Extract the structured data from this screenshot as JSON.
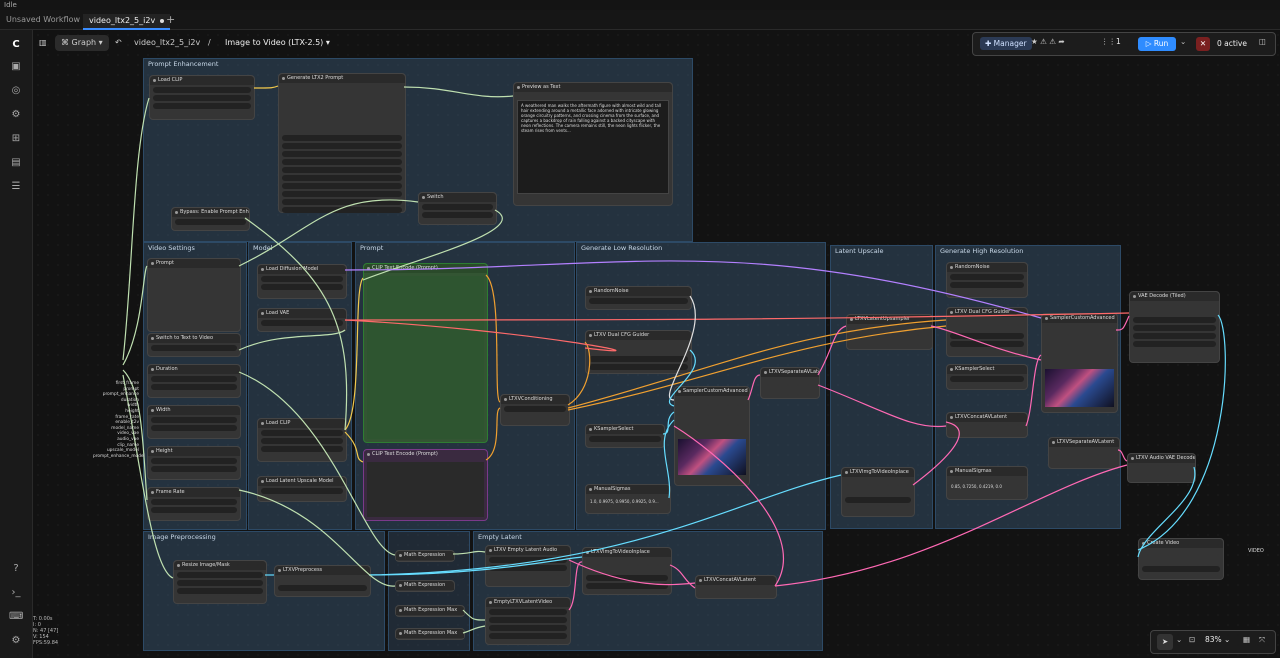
{
  "window": {
    "title": "Idle"
  },
  "tabs": [
    {
      "label": "Unsaved Workflow",
      "active": false
    },
    {
      "label": "video_ltx2_5_i2v",
      "active": true
    }
  ],
  "topbar": {
    "mode": "Graph",
    "breadcrumb_file": "video_ltx2_5_i2v",
    "breadcrumb_sep": "/",
    "breadcrumb_title": "Image to Video (LTX-2.5)"
  },
  "run_controls": {
    "manager": "Manager",
    "batch_count": "1",
    "run": "Run",
    "active": "0 active"
  },
  "zoom": {
    "level": "83%"
  },
  "stats": [
    "T: 0.00s",
    "I: 0",
    "N: 47 [47]",
    "V: 154",
    "FPS:59.84"
  ],
  "groups": [
    {
      "title": "Prompt Enhancement"
    },
    {
      "title": "Video Settings"
    },
    {
      "title": "Model"
    },
    {
      "title": "Prompt"
    },
    {
      "title": "Generate Low Resolution"
    },
    {
      "title": "Latent Upscale"
    },
    {
      "title": "Generate High Resolution"
    },
    {
      "title": "Image Preprocessing"
    },
    {
      "title": "Empty Latent"
    }
  ],
  "nodes": [
    {
      "title": "Load CLIP"
    },
    {
      "title": "Generate LTX2 Prompt"
    },
    {
      "title": "Preview as Text"
    },
    {
      "title": "Bypass: Enable Prompt Enha..."
    },
    {
      "title": "Switch"
    },
    {
      "title": "Prompt"
    },
    {
      "title": "Load Diffusion Model"
    },
    {
      "title": "Load VAE"
    },
    {
      "title": "Load CLIP"
    },
    {
      "title": "Switch to Text to Video"
    },
    {
      "title": "Duration"
    },
    {
      "title": "Width"
    },
    {
      "title": "Height"
    },
    {
      "title": "Frame Rate"
    },
    {
      "title": "Load Latent Upscale Model"
    },
    {
      "title": "CLIP Text Encode (Prompt)"
    },
    {
      "title": "CLIP Text Encode (Prompt)"
    },
    {
      "title": "LTXVConditioning"
    },
    {
      "title": "RandomNoise"
    },
    {
      "title": "LTXV Dual CFG Guider"
    },
    {
      "title": "KSamplerSelect"
    },
    {
      "title": "ManualSigmas"
    },
    {
      "title": "SamplerCustomAdvanced"
    },
    {
      "title": "LTXVSeparateAVLatent"
    },
    {
      "title": "LTXVLatentUpsampler"
    },
    {
      "title": "LTXVImgToVideoInplace"
    },
    {
      "title": "RandomNoise"
    },
    {
      "title": "LTXV Dual CFG Guider"
    },
    {
      "title": "KSamplerSelect"
    },
    {
      "title": "LTXVConcatAVLatent"
    },
    {
      "title": "ManualSigmas"
    },
    {
      "title": "SamplerCustomAdvanced"
    },
    {
      "title": "LTXVSeparateAVLatent"
    },
    {
      "title": "VAE Decode (Tiled)"
    },
    {
      "title": "LTXV Audio VAE Decode"
    },
    {
      "title": "Create Video"
    },
    {
      "title": "Resize Image/Mask"
    },
    {
      "title": "LTXVPreprocess"
    },
    {
      "title": "Math Expression"
    },
    {
      "title": "Math Expression"
    },
    {
      "title": "Math Expression Max"
    },
    {
      "title": "Math Expression Max"
    },
    {
      "title": "LTXV Empty Latent Audio"
    },
    {
      "title": "LTXVImgToVideoInplace"
    },
    {
      "title": "EmptyLTXVLatentVideo"
    },
    {
      "title": "LTXVConcatAVLatent"
    }
  ],
  "preview_text": "A weathered man walks the aftermath figure with almost wild and tall hair extending around a metallic face adorned with intricate glowing orange circuitry patterns, and crossing cinema from the surface, and captures a backdrop of rain falling against a backed cityscape with neon reflections. The camera remains still, the neon lights flicker, the steam rises from vents...",
  "manual_sigmas": "1.0, 0.9975, 0.9950, 0.9925, 0.9...",
  "manual_sigmas_hi": "0.85, 0.7250, 0.4219, 0.0",
  "left_labels": [
    "first_frame",
    "prompt",
    "prompt_enhance",
    "duration",
    "width",
    "height",
    "frame_rate",
    "enable_t2v",
    "model_name",
    "video_vae",
    "audio_vae",
    "clip_name",
    "upscale_model",
    "prompt_enhance_model"
  ],
  "node_values": {
    "step_value": "24fps",
    "out_video": "VIDEO",
    "badge_fps": "25fps"
  }
}
